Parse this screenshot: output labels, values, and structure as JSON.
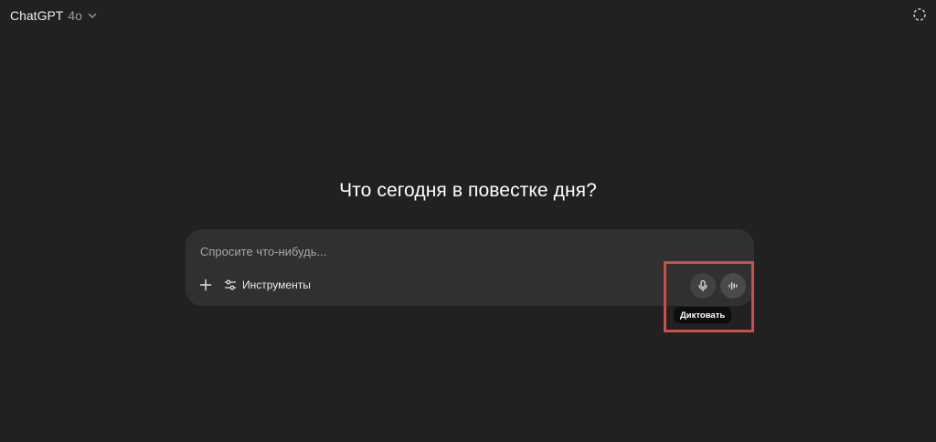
{
  "header": {
    "model_name": "ChatGPT",
    "model_version": "4o",
    "icons": {
      "model_dropdown": "chevron-down-icon",
      "temporary_chat": "dashed-circle-icon"
    }
  },
  "main": {
    "headline": "Что сегодня в повестке дня?"
  },
  "composer": {
    "placeholder": "Спросите что-нибудь...",
    "value": "",
    "tools_label": "Инструменты",
    "icons": {
      "attach": "plus-icon",
      "tools": "sliders-icon",
      "dictate": "microphone-icon",
      "voice_mode": "voice-waveform-icon"
    }
  },
  "tooltip": {
    "text": "Диктовать"
  },
  "colors": {
    "background": "#212121",
    "composer": "#303030",
    "highlight": "#c9504b",
    "tooltip_bg": "#0d0d0d"
  }
}
